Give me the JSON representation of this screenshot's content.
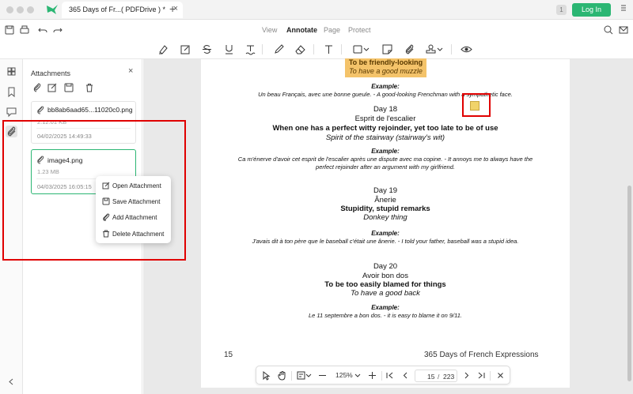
{
  "window": {
    "tab_title": "365 Days of Fr...( PDFDrive ) *",
    "tab_close": "×",
    "tab_add": "+",
    "user_badge": "1",
    "login_label": "Log In"
  },
  "menu": {
    "tabs": [
      {
        "label": "View"
      },
      {
        "label": "Annotate"
      },
      {
        "label": "Page"
      },
      {
        "label": "Protect"
      }
    ],
    "active": "Annotate"
  },
  "panel": {
    "title": "Attachments",
    "close": "×",
    "items": [
      {
        "name": "bb8ab6aad65...11020c0.png",
        "size": "2.12.01 KB",
        "date": "04/02/2025 14:49:33"
      },
      {
        "name": "image4.png",
        "size": "1.23 MB",
        "date": "04/03/2025 16:05:15"
      }
    ]
  },
  "context_menu": {
    "items": [
      {
        "label": "Open Attachment",
        "icon": "open-attachment-icon"
      },
      {
        "label": "Save Attachment",
        "icon": "save-icon"
      },
      {
        "label": "Add Attachment",
        "icon": "add-attachment-icon"
      },
      {
        "label": "Delete Attachment",
        "icon": "trash-icon"
      }
    ]
  },
  "document": {
    "highlight_lines": [
      "To be friendly-looking",
      "To have a good muzzle"
    ],
    "example_label": "Example:",
    "entries": [
      {
        "example": "Un beau Français, avec une bonne gueule. - A good-looking Frenchman with a sympathetic face."
      },
      {
        "day": "Day 18",
        "french": "Esprit de l'escalier",
        "english": "When one has a perfect witty rejoinder, yet too late to be of use",
        "literal": "Spirit of the stairway (stairway's wit)",
        "example_lines": [
          "Ca m'énerve d'avoir cet esprit de l'escalier après une dispute avec ma copine. - It annoys me to always have the",
          "perfect rejoinder after an argument with my girlfriend."
        ]
      },
      {
        "day": "Day 19",
        "french": "Ânerie",
        "english": "Stupidity, stupid remarks",
        "literal": "Donkey thing",
        "example_lines": [
          "J'avais dit à ton père que le baseball c'était une ânerie. - I told your father, baseball  was a stupid idea."
        ]
      },
      {
        "day": "Day 20",
        "french": "Avoir bon dos",
        "english": "To be too easily blamed for things",
        "literal": "To have a good back",
        "example_lines": [
          "Le 11 septembre a bon dos. - it is easy to blame it on 9/11."
        ]
      }
    ],
    "footer_page": "15",
    "footer_title": "365 Days of French Expressions"
  },
  "navbar": {
    "zoom": "125%",
    "current_page": "15",
    "separator": "/",
    "total_pages": "223"
  },
  "colors": {
    "accent": "#2bb673",
    "highlight": "#f4c36a",
    "annotation_frame": "#e00000"
  }
}
